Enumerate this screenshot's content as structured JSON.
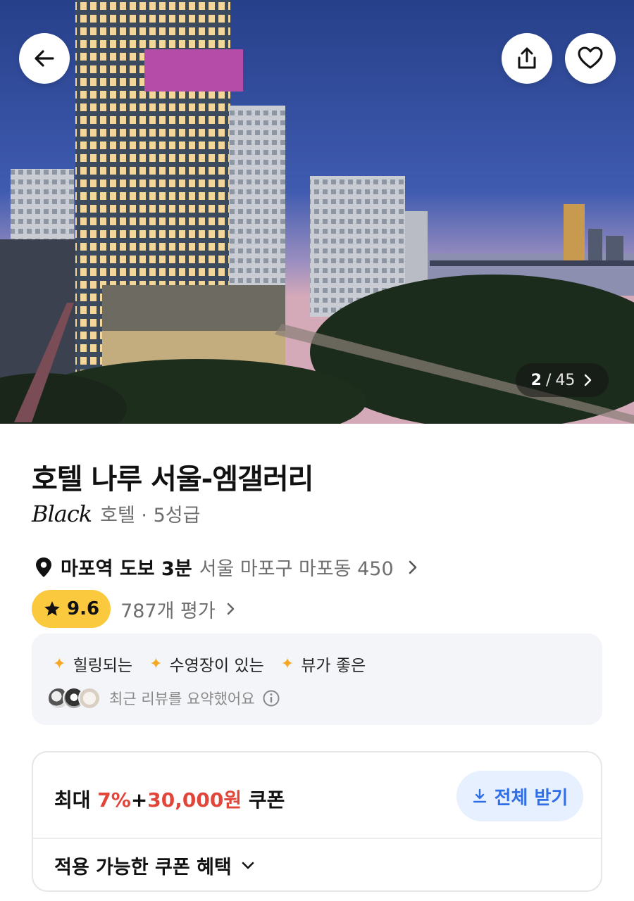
{
  "gallery": {
    "current": "2",
    "separator": "/",
    "total": "45"
  },
  "hotel": {
    "name": "호텔 나루 서울-엠갤러리",
    "brand": "Black",
    "type_grade": "호텔 · 5성급"
  },
  "location": {
    "station": "마포역 도보 3분",
    "address": "서울 마포구 마포동 450"
  },
  "rating": {
    "score": "9.6",
    "review_count": "787개 평가"
  },
  "summary": {
    "tags": [
      "힐링되는",
      "수영장이 있는",
      "뷰가 좋은"
    ],
    "note": "최근 리뷰를 요약했어요"
  },
  "coupon": {
    "prefix": "최대 ",
    "percent": "7%",
    "plus": "+",
    "amount": "30,000원",
    "suffix": " 쿠폰",
    "button_label": "전체 받기",
    "benefits_label": "적용 가능한 쿠폰 혜택"
  },
  "colors": {
    "rating_badge": "#fbc93d",
    "coupon_red": "#e2463b",
    "button_blue": "#2f6fe8",
    "button_bg": "#e6f0ff",
    "sparkle": "#f5a623"
  },
  "icons": {
    "back": "arrow-left-icon",
    "share": "share-icon",
    "like": "heart-icon",
    "location": "location-pin-icon",
    "star": "star-icon",
    "info": "info-icon",
    "download": "download-icon"
  }
}
